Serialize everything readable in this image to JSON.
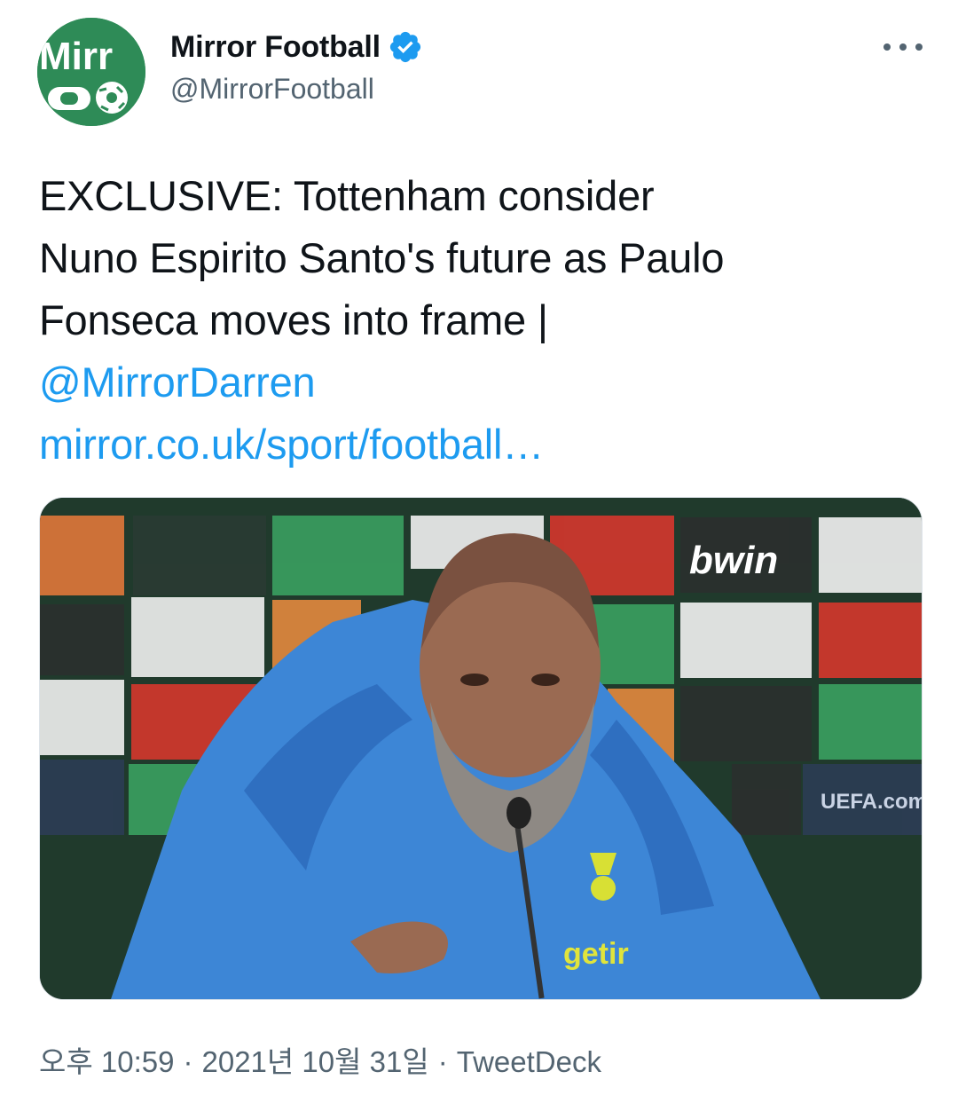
{
  "author": {
    "display_name": "Mirror Football",
    "handle": "@MirrorFootball",
    "avatar_logo_text": "Mirr",
    "verified": true
  },
  "tweet": {
    "lines": [
      "EXCLUSIVE: Tottenham consider",
      "Nuno Espirito Santo's future as Paulo",
      "Fonseca moves into frame |"
    ],
    "mention": "@MirrorDarren",
    "link": "mirror.co.uk/sport/football…"
  },
  "media": {
    "sponsor_text": "bwin",
    "shirt_text": "getir",
    "board_text": "UEFA.com"
  },
  "meta": {
    "time": "오후 10:59",
    "date": "2021년 10월 31일",
    "source": "TweetDeck",
    "separator": "·"
  },
  "colors": {
    "link": "#1d9bf0",
    "verified": "#1d9bf0",
    "avatar_bg": "#2e8b57",
    "secondary_text": "#536471"
  },
  "icons": {
    "verified": "verified-badge-icon",
    "more": "more-dots-icon"
  }
}
